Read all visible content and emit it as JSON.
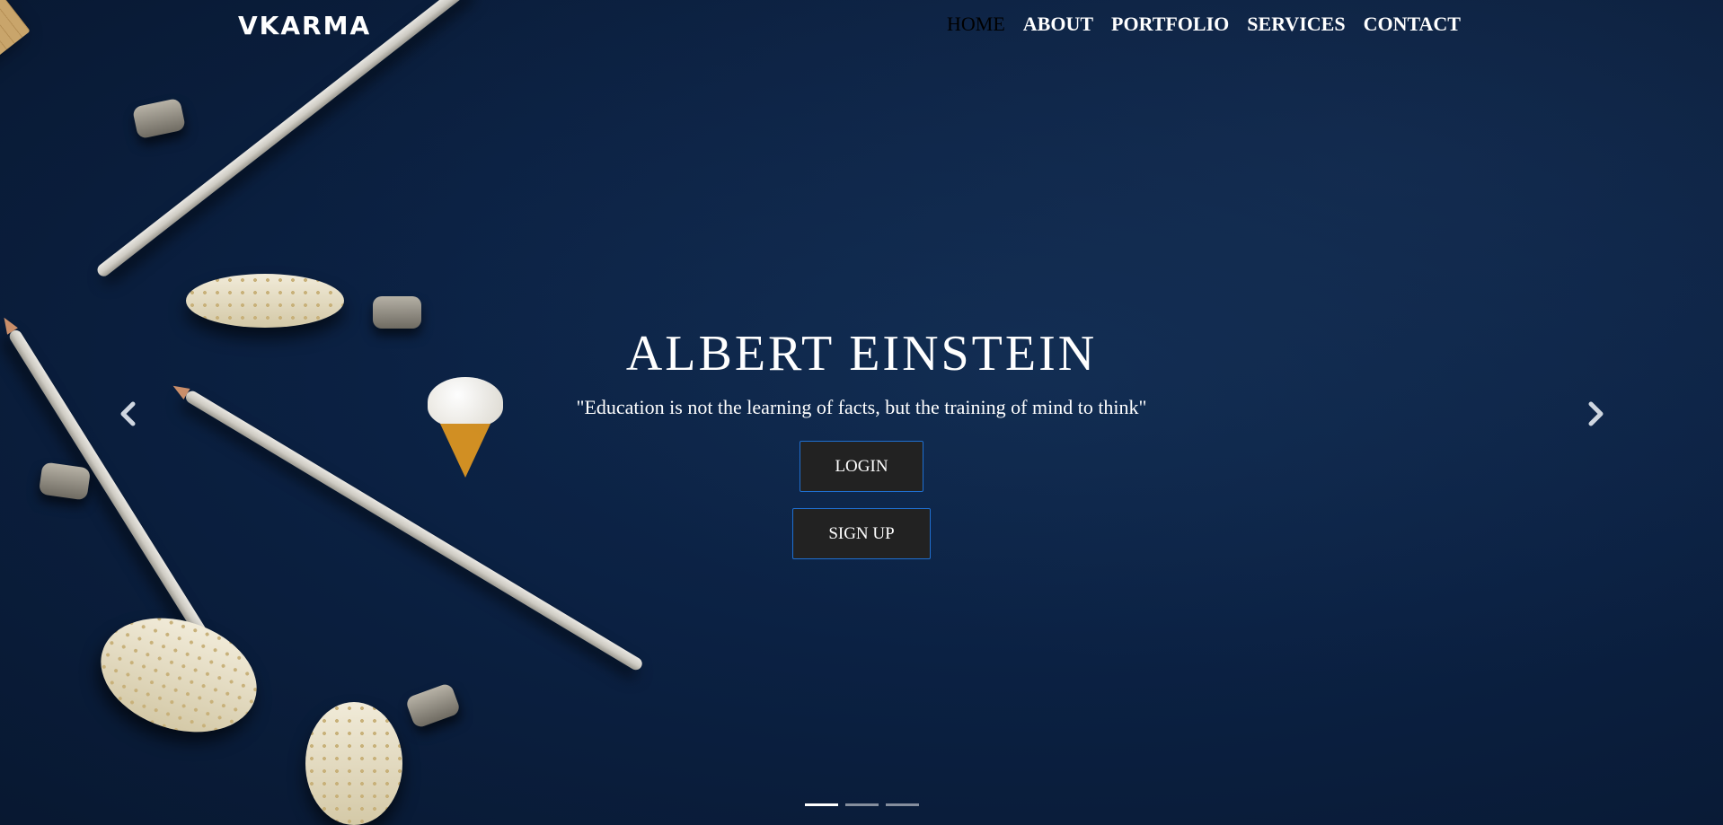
{
  "brand": {
    "name": "VKARMA"
  },
  "nav": {
    "items": [
      {
        "label": "HOME",
        "active": true
      },
      {
        "label": "ABOUT",
        "active": false
      },
      {
        "label": "PORTFOLIO",
        "active": false
      },
      {
        "label": "SERVICES",
        "active": false
      },
      {
        "label": "CONTACT",
        "active": false
      }
    ]
  },
  "hero": {
    "title": "ALBERT EINSTEIN",
    "quote": "\"Education is not the learning of facts, but the training of mind to think\"",
    "login_label": "LOGIN",
    "signup_label": "SIGN UP"
  },
  "carousel": {
    "prev_icon": "chevron-left-icon",
    "next_icon": "chevron-right-icon",
    "slide_count": 3,
    "active_slide": 1
  },
  "colors": {
    "background": "#0b2143",
    "button_bg": "#222222",
    "button_border": "#1f6fd0",
    "text": "#ffffff"
  }
}
